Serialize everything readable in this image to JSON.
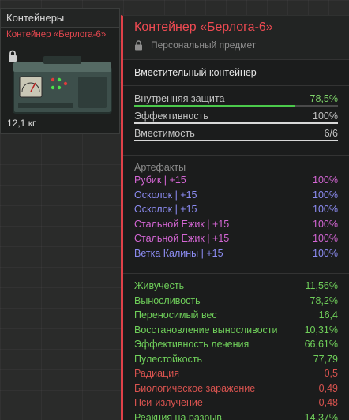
{
  "inventory": {
    "header": "Контейнеры",
    "item_name": "Контейнер «Берлога-6»",
    "weight": "12,1 кг"
  },
  "tooltip": {
    "title": "Контейнер «Берлога-6»",
    "subtitle": "Персональный предмет",
    "description": "Вместительный контейнер",
    "accent_color": "#e04149",
    "stats": [
      {
        "label": "Внутренняя защита",
        "value": "78,5%",
        "fill": 0.785,
        "color": "green"
      },
      {
        "label": "Эффективность",
        "value": "100%",
        "fill": 1.0,
        "color": "white"
      },
      {
        "label": "Вместимость",
        "value": "6/6",
        "fill": 1.0,
        "color": "white"
      }
    ],
    "artifacts_title": "Артефакты",
    "artifacts": [
      {
        "name": "Рубик | +15",
        "value": "100%",
        "color": "#d466d4"
      },
      {
        "name": "Осколок | +15",
        "value": "100%",
        "color": "#8c8cf2"
      },
      {
        "name": "Осколок | +15",
        "value": "100%",
        "color": "#8c8cf2"
      },
      {
        "name": "Стальной Ежик | +15",
        "value": "100%",
        "color": "#d466d4"
      },
      {
        "name": "Стальной Ежик | +15",
        "value": "100%",
        "color": "#d466d4"
      },
      {
        "name": "Ветка Калины | +15",
        "value": "100%",
        "color": "#8c8cf2"
      }
    ],
    "effects": [
      {
        "name": "Живучесть",
        "value": "11,56%",
        "color": "#6fcf5a"
      },
      {
        "name": "Выносливость",
        "value": "78,2%",
        "color": "#6fcf5a"
      },
      {
        "name": "Переносимый вес",
        "value": "16,4",
        "color": "#6fcf5a"
      },
      {
        "name": "Восстановление выносливости",
        "value": "10,31%",
        "color": "#6fcf5a"
      },
      {
        "name": "Эффективность лечения",
        "value": "66,61%",
        "color": "#6fcf5a"
      },
      {
        "name": "Пулестойкость",
        "value": "77,79",
        "color": "#6fcf5a"
      },
      {
        "name": "Радиация",
        "value": "0,5",
        "color": "#d9534f"
      },
      {
        "name": "Биологическое заражение",
        "value": "0,49",
        "color": "#d9534f"
      },
      {
        "name": "Пси-излучение",
        "value": "0,48",
        "color": "#d9534f"
      },
      {
        "name": "Реакция на разрыв",
        "value": "14,37%",
        "color": "#6fcf5a"
      }
    ]
  }
}
